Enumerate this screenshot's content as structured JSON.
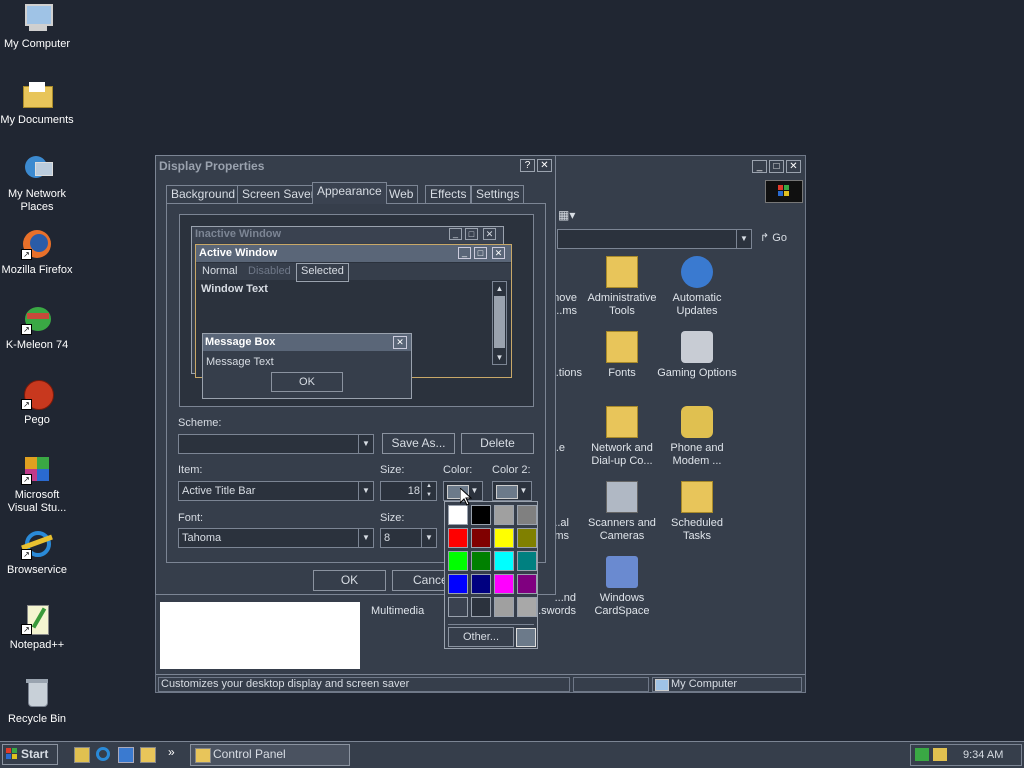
{
  "desktop": {
    "icons": [
      {
        "label": "My Computer"
      },
      {
        "label": "My Documents"
      },
      {
        "label": "My Network Places"
      },
      {
        "label": "Mozilla Firefox"
      },
      {
        "label": "K-Meleon 74"
      },
      {
        "label": "Pego"
      },
      {
        "label": "Microsoft Visual Stu..."
      },
      {
        "label": "Browservice"
      },
      {
        "label": "Notepad++"
      },
      {
        "label": "Recycle Bin"
      }
    ]
  },
  "control_panel": {
    "go_label": "Go",
    "icons": [
      {
        "label": "...nove ...ms"
      },
      {
        "label": "Administrative Tools"
      },
      {
        "label": "Automatic Updates"
      },
      {
        "label": "...tions"
      },
      {
        "label": "Fonts"
      },
      {
        "label": "Gaming Options"
      },
      {
        "label": "...e"
      },
      {
        "label": "Network and Dial-up Co..."
      },
      {
        "label": "Phone and Modem ..."
      },
      {
        "label": "...al ...ms"
      },
      {
        "label": "Scanners and Cameras"
      },
      {
        "label": "Scheduled Tasks"
      },
      {
        "label": "...nd ...swords"
      },
      {
        "label": "Windows CardSpace"
      }
    ],
    "side_text": "Multimedia",
    "status_left": "Customizes your desktop display and screen saver",
    "status_right": "My Computer"
  },
  "dialog": {
    "title": "Display Properties",
    "help_glyph": "?",
    "close_glyph": "✕",
    "tabs": [
      {
        "label": "Background"
      },
      {
        "label": "Screen Saver"
      },
      {
        "label": "Appearance"
      },
      {
        "label": "Web"
      },
      {
        "label": "Effects"
      },
      {
        "label": "Settings"
      }
    ],
    "preview": {
      "inactive_title": "Inactive Window",
      "active_title": "Active Window",
      "menu": [
        "Normal",
        "Disabled",
        "Selected"
      ],
      "window_text": "Window Text",
      "msgbox_title": "Message Box",
      "msgbox_text": "Message Text",
      "msgbox_ok": "OK"
    },
    "scheme_label": "Scheme:",
    "scheme_value": "",
    "save_as_label": "Save As...",
    "delete_label": "Delete",
    "item_label": "Item:",
    "item_value": "Active Title Bar",
    "size_label": "Size:",
    "size_value": "18",
    "color_label": "Color:",
    "color2_label": "Color 2:",
    "font_label": "Font:",
    "font_value": "Tahoma",
    "font_size_label": "Size:",
    "font_size_value": "8",
    "ok_label": "OK",
    "cancel_label": "Cance"
  },
  "color_popup": {
    "swatches": [
      "#ffffff",
      "#000000",
      "#a0a0a0",
      "#808080",
      "#ff0000",
      "#800000",
      "#ffff00",
      "#808000",
      "#00ff00",
      "#008000",
      "#00ffff",
      "#008080",
      "#0000ff",
      "#000080",
      "#ff00ff",
      "#800080",
      "#3a4250",
      "#2b323d",
      "#a0a0a0",
      "#a8a8a8"
    ],
    "other_label": "Other...",
    "current_color": "#6c7a8a"
  },
  "taskbar": {
    "start_label": "Start",
    "window_button": "Control Panel",
    "chevron": "»",
    "clock": "9:34 AM"
  }
}
